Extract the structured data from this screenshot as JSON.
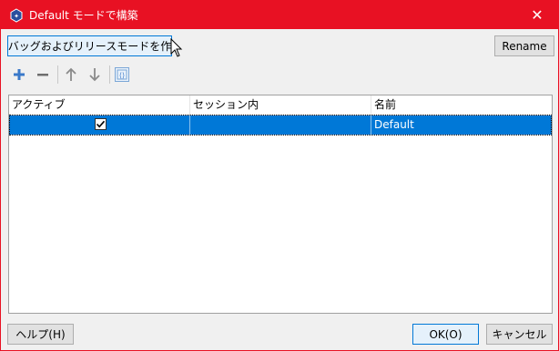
{
  "window": {
    "title": "Default モードで構築",
    "close_glyph": "✕"
  },
  "toolbar": {
    "create_button_label": "デバッグおよびリリースモードを作成",
    "rename_button_label": "Rename",
    "icons": [
      "add-icon",
      "remove-icon",
      "move-up-icon",
      "move-down-icon",
      "edit-icon"
    ]
  },
  "table": {
    "columns": [
      "アクティブ",
      "セッション内",
      "名前"
    ],
    "rows": [
      {
        "active": true,
        "in_session": "",
        "name": "Default",
        "selected": true
      }
    ]
  },
  "footer": {
    "help_label": "ヘルプ(H)",
    "ok_label": "OK(O)",
    "cancel_label": "キャンセル"
  },
  "colors": {
    "titlebar": "#e81123",
    "selection": "#0078d7",
    "focus_border": "#0078d7"
  }
}
